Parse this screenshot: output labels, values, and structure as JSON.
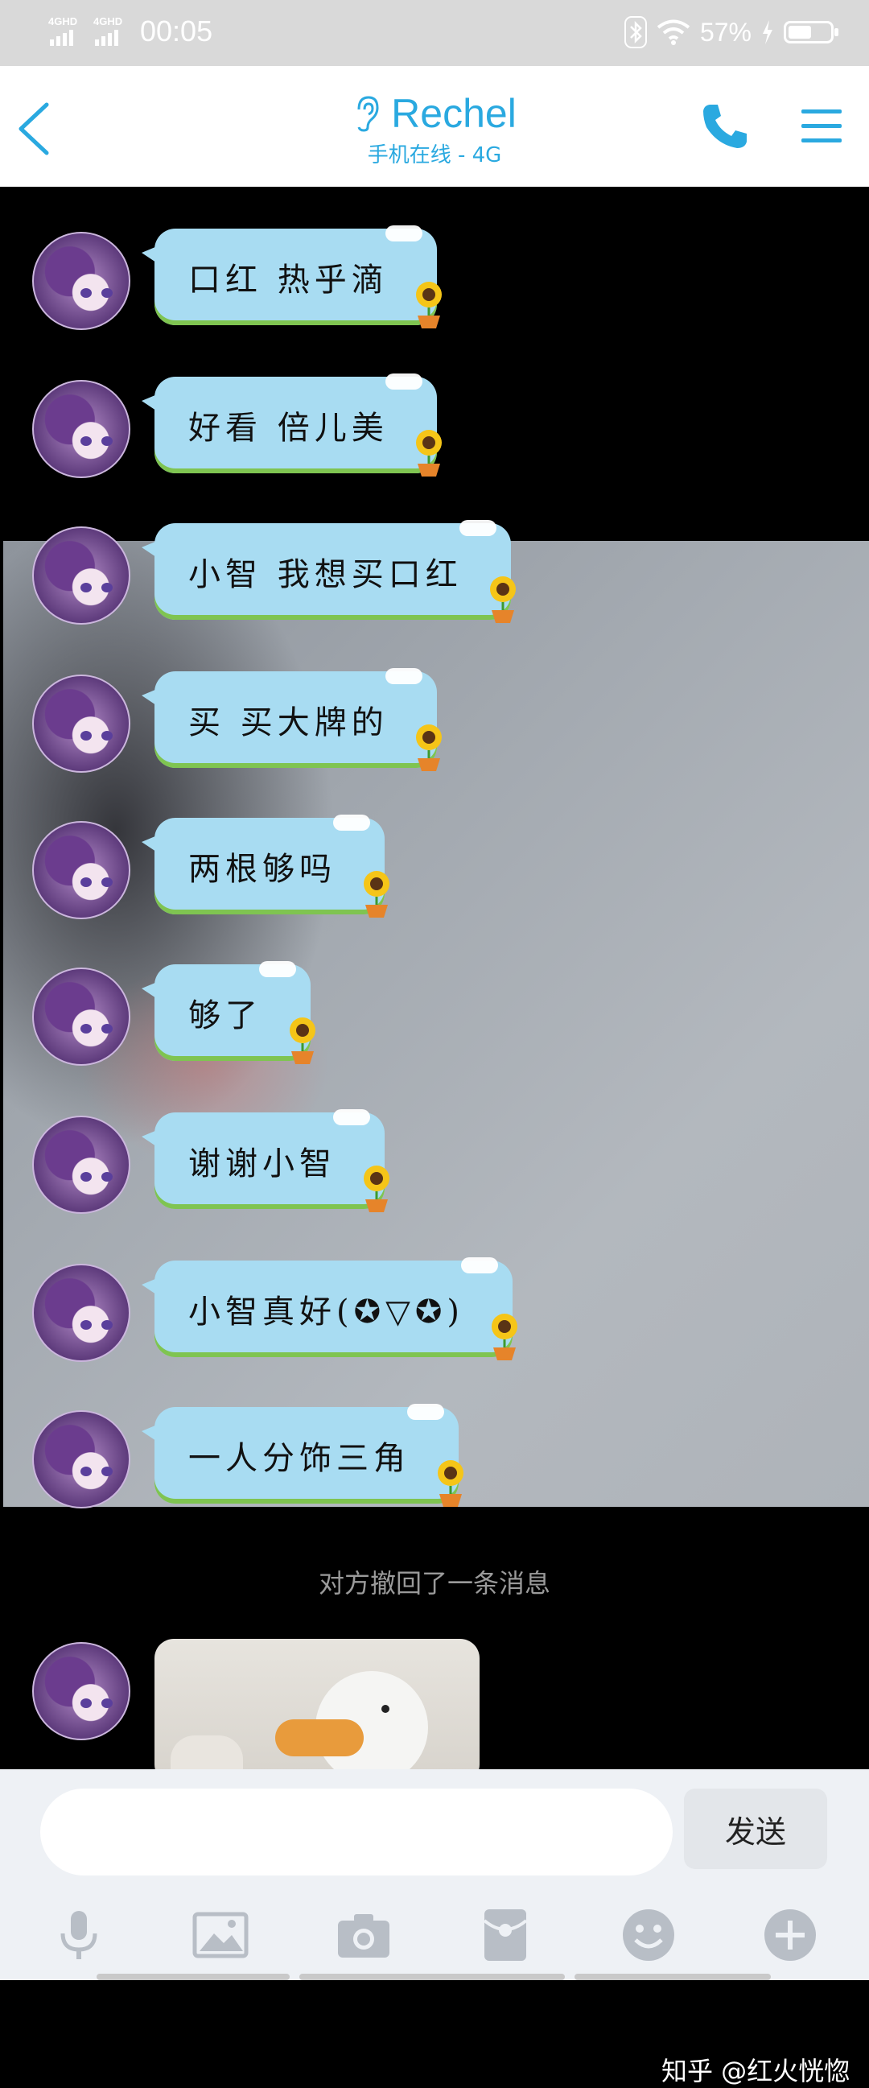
{
  "status_bar": {
    "signal_1": "4GHD",
    "signal_2": "4GHD",
    "time": "00:05",
    "battery_percent": "57%",
    "battery_level": 0.57,
    "icons": [
      "bluetooth-icon",
      "wifi-icon",
      "charging-icon",
      "battery-icon"
    ]
  },
  "header": {
    "title": "Rechel",
    "subtitle": "手机在线 - 4G",
    "icons": [
      "back-icon",
      "ear-icon",
      "phone-icon",
      "menu-icon"
    ],
    "accent_color": "#2aa9e0"
  },
  "messages": [
    {
      "text": "口红 热乎滴"
    },
    {
      "text": "好看 倍儿美"
    },
    {
      "text": "小智 我想买口红"
    },
    {
      "text": "买 买大牌的"
    },
    {
      "text": "两根够吗"
    },
    {
      "text": "够了"
    },
    {
      "text": "谢谢小智"
    },
    {
      "text": "小智真好(✪▽✪)"
    },
    {
      "text": "一人分饰三角"
    }
  ],
  "recall_notice": "对方撤回了一条消息",
  "input": {
    "value": "",
    "send_label": "发送"
  },
  "toolbar": {
    "icons": [
      "microphone-icon",
      "image-icon",
      "camera-icon",
      "red-packet-icon",
      "emoji-icon",
      "plus-icon"
    ]
  },
  "watermark": "知乎 @红火恍惚"
}
